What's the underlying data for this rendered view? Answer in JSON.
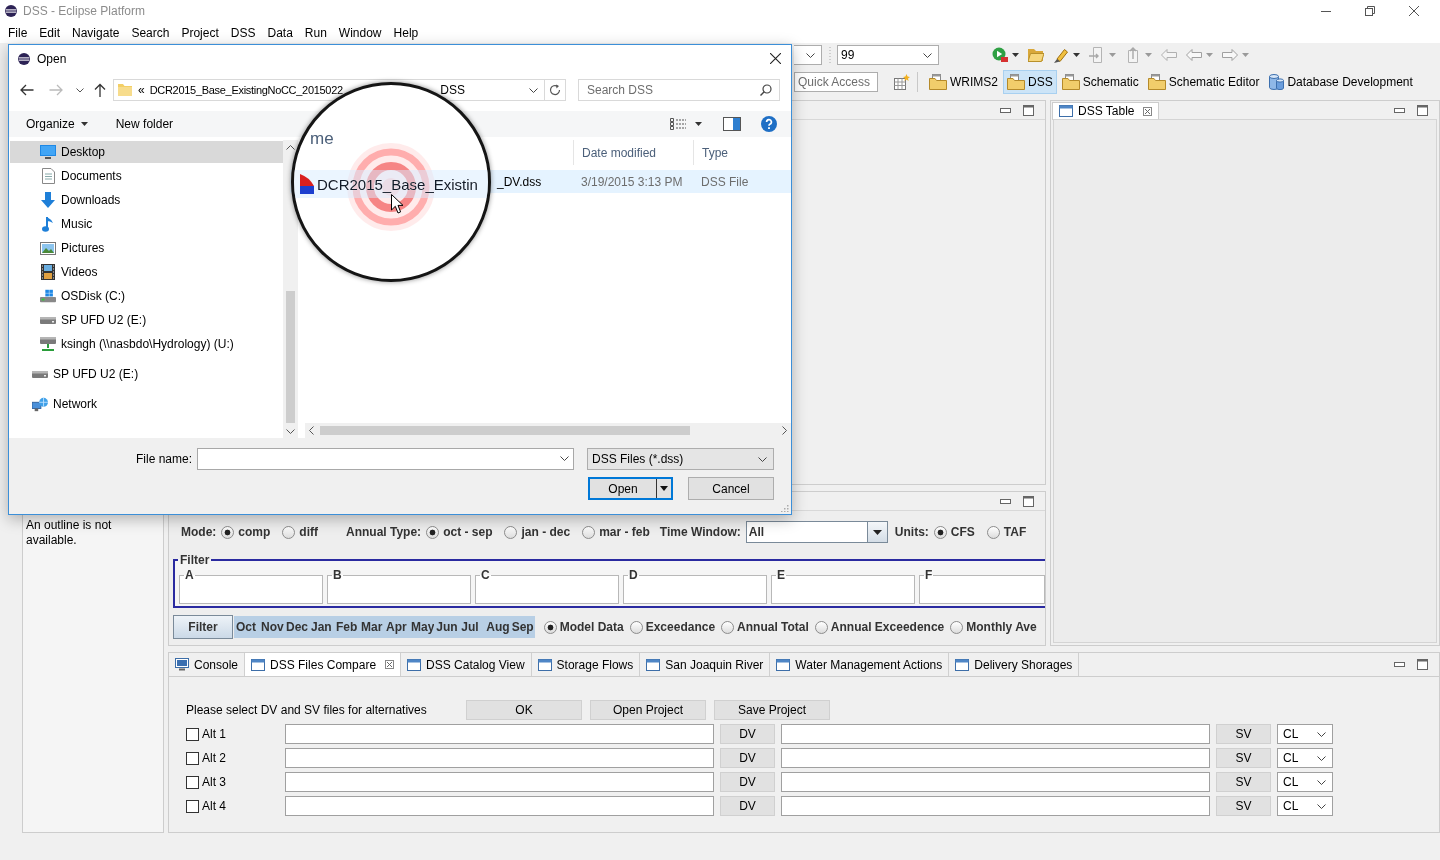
{
  "window": {
    "title": "DSS - Eclipse Platform"
  },
  "menu_bar": [
    "File",
    "Edit",
    "Navigate",
    "Search",
    "Project",
    "DSS",
    "Data",
    "Run",
    "Window",
    "Help"
  ],
  "toolbar": {
    "combo_value": "99"
  },
  "perspective_bar": {
    "quick_access_placeholder": "Quick Access",
    "perspectives": [
      {
        "label": "WRIMS2",
        "kind": "folder",
        "selected": false
      },
      {
        "label": "DSS",
        "kind": "folder",
        "selected": true
      },
      {
        "label": "Schematic",
        "kind": "folder",
        "selected": false
      },
      {
        "label": "Schematic Editor",
        "kind": "folder",
        "selected": false
      },
      {
        "label": "Database Development",
        "kind": "database",
        "selected": false
      }
    ]
  },
  "dss_table_view": {
    "tab": "DSS Table"
  },
  "outline_view": {
    "message": "An outline is not available."
  },
  "controls_panel": {
    "mode": {
      "label": "Mode:",
      "options": [
        {
          "label": "comp",
          "selected": true
        },
        {
          "label": "diff",
          "selected": false
        }
      ]
    },
    "annual_type": {
      "label": "Annual Type:",
      "options": [
        {
          "label": "oct - sep",
          "selected": true
        },
        {
          "label": "jan - dec",
          "selected": false
        },
        {
          "label": "mar - feb",
          "selected": false
        }
      ]
    },
    "time_window": {
      "label": "Time Window:",
      "value": "All"
    },
    "units": {
      "label": "Units:",
      "options": [
        {
          "label": "CFS",
          "selected": true
        },
        {
          "label": "TAF",
          "selected": false
        }
      ]
    },
    "filter": {
      "title": "Filter",
      "fields": [
        "A",
        "B",
        "C",
        "D",
        "E",
        "F"
      ]
    },
    "filter_button": "Filter",
    "months": [
      {
        "label": "Oct",
        "selected": true
      },
      {
        "label": "Nov",
        "selected": true
      },
      {
        "label": "Dec",
        "selected": true
      },
      {
        "label": "Jan",
        "selected": true
      },
      {
        "label": "Feb",
        "selected": true
      },
      {
        "label": "Mar",
        "selected": true
      },
      {
        "label": "Apr",
        "selected": true
      },
      {
        "label": "May",
        "selected": true
      },
      {
        "label": "Jun",
        "selected": true
      },
      {
        "label": "Jul",
        "selected": true
      },
      {
        "label": "Aug",
        "selected": true
      },
      {
        "label": "Sep",
        "selected": true
      }
    ],
    "display": [
      {
        "label": "Model Data",
        "selected": true
      },
      {
        "label": "Exceedance",
        "selected": false
      },
      {
        "label": "Annual Total",
        "selected": false
      },
      {
        "label": "Annual Exceedence",
        "selected": false
      },
      {
        "label": "Monthly Ave",
        "selected": false
      }
    ]
  },
  "bottom_panel": {
    "tabs": [
      {
        "label": "Console",
        "kind": "console",
        "selected": false
      },
      {
        "label": "DSS Files Compare",
        "kind": "view",
        "selected": true
      },
      {
        "label": "DSS Catalog View",
        "kind": "view",
        "selected": false
      },
      {
        "label": "Storage Flows",
        "kind": "view",
        "selected": false
      },
      {
        "label": "San Joaquin River",
        "kind": "view",
        "selected": false
      },
      {
        "label": "Water Management Actions",
        "kind": "view",
        "selected": false
      },
      {
        "label": "Delivery Shorages",
        "kind": "view",
        "selected": false
      }
    ],
    "instruction": "Please select DV and SV files for alternatives",
    "buttons": [
      "OK",
      "Open Project",
      "Save Project"
    ],
    "alternatives": [
      {
        "label": "Alt 1",
        "checked": false,
        "dv_button": "DV",
        "sv_button": "SV",
        "type": "CL"
      },
      {
        "label": "Alt 2",
        "checked": false,
        "dv_button": "DV",
        "sv_button": "SV",
        "type": "CL"
      },
      {
        "label": "Alt 3",
        "checked": false,
        "dv_button": "DV",
        "sv_button": "SV",
        "type": "CL"
      },
      {
        "label": "Alt 4",
        "checked": false,
        "dv_button": "DV",
        "sv_button": "SV",
        "type": "CL"
      }
    ]
  },
  "open_dialog": {
    "title": "Open",
    "path": {
      "overflow_mark": "«",
      "start": "DCR2015_Base_ExistingNoCC_2015022",
      "end": "DSS"
    },
    "search_placeholder": "Search DSS",
    "commands": [
      {
        "label": "Organize",
        "kind": "menu"
      },
      {
        "label": "New folder",
        "kind": "plain"
      }
    ],
    "nav_pane": {
      "sub_items": [
        {
          "label": "Desktop",
          "kind": "desktop",
          "selected": true
        },
        {
          "label": "Documents",
          "kind": "documents",
          "selected": false
        },
        {
          "label": "Downloads",
          "kind": "downloads",
          "selected": false
        },
        {
          "label": "Music",
          "kind": "music",
          "selected": false
        },
        {
          "label": "Pictures",
          "kind": "pictures",
          "selected": false
        },
        {
          "label": "Videos",
          "kind": "videos",
          "selected": false
        },
        {
          "label": "OSDisk (C:)",
          "kind": "disk",
          "selected": false
        },
        {
          "label": "SP UFD U2 (E:)",
          "kind": "drive",
          "selected": false
        },
        {
          "label": "ksingh (\\\\nasbdo\\Hydrology) (U:)",
          "kind": "share",
          "selected": false
        }
      ],
      "items": [
        {
          "label": "SP UFD U2 (E:)",
          "kind": "drive",
          "selected": false
        },
        {
          "label": "Network",
          "kind": "network",
          "selected": false
        }
      ]
    },
    "columns": [
      "Date modified",
      "Type"
    ],
    "files": [
      {
        "name_end": "_DV.dss",
        "date_modified": "3/19/2015 3:13 PM",
        "type": "DSS File",
        "highlighted": true
      }
    ],
    "file_name_label": "File name:",
    "file_type": "DSS Files (*.dss)",
    "buttons": [
      {
        "label": "Open",
        "kind": "split"
      },
      {
        "label": "Cancel",
        "kind": "plain"
      }
    ]
  },
  "magnifier": {
    "header_text": "me",
    "file_text": "DCR2015_Base_Existin"
  }
}
